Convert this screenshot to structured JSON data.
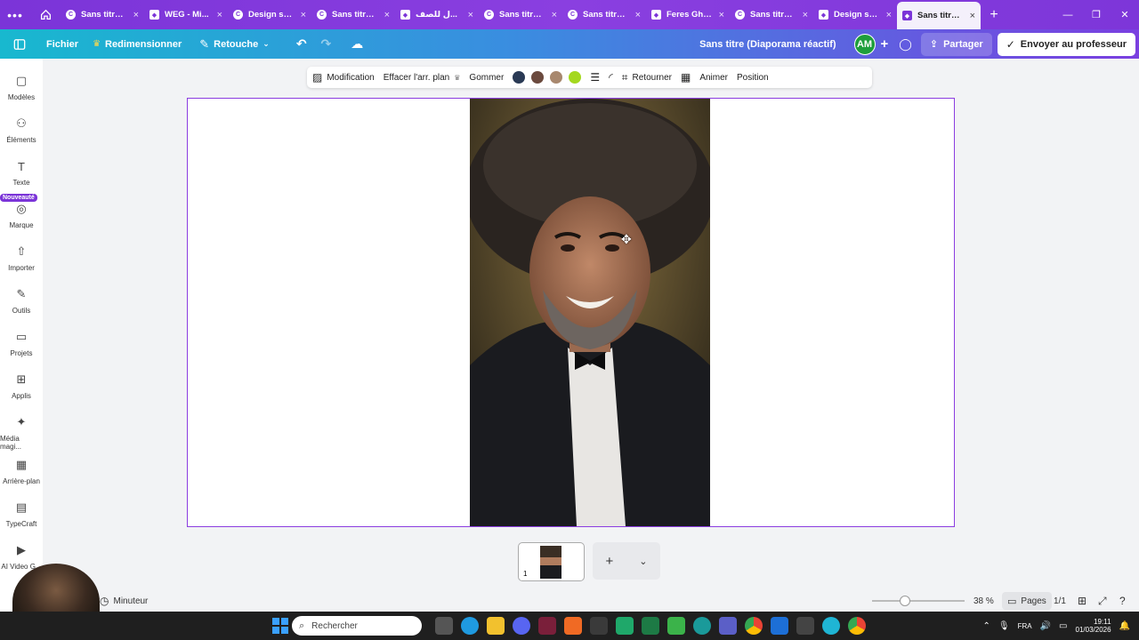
{
  "browser": {
    "tabs": [
      {
        "title": "Sans titre ...",
        "icon": "canva",
        "active": false
      },
      {
        "title": "WEG - Mi...",
        "icon": "shield",
        "active": false
      },
      {
        "title": "Design sa...",
        "icon": "canva",
        "active": false
      },
      {
        "title": "Sans titre ...",
        "icon": "canva",
        "active": false
      },
      {
        "title": "ل للصف...",
        "icon": "shield",
        "active": false
      },
      {
        "title": "Sans titre ...",
        "icon": "canva",
        "active": false
      },
      {
        "title": "Sans titre ...",
        "icon": "canva",
        "active": false
      },
      {
        "title": "Feres Gha...",
        "icon": "shield",
        "active": false
      },
      {
        "title": "Sans titre ...",
        "icon": "canva",
        "active": false
      },
      {
        "title": "Design sa...",
        "icon": "shield",
        "active": false
      },
      {
        "title": "Sans titre ...",
        "icon": "shield",
        "active": true
      }
    ],
    "close_glyph": "×",
    "new_tab": "+"
  },
  "header": {
    "file": "Fichier",
    "resize": "Redimensionner",
    "retouch": "Retouche",
    "doc_title": "Sans titre (Diaporama réactif)",
    "avatar": "AM",
    "share": "Partager",
    "send_teacher": "Envoyer au professeur"
  },
  "sidebar": {
    "items": [
      {
        "label": "Modèles",
        "icon": "templates-icon"
      },
      {
        "label": "Éléments",
        "icon": "elements-icon"
      },
      {
        "label": "Texte",
        "icon": "text-icon"
      },
      {
        "label": "Marque",
        "icon": "brand-icon"
      },
      {
        "label": "Importer",
        "icon": "upload-icon"
      },
      {
        "label": "Outils",
        "icon": "tools-icon"
      },
      {
        "label": "Projets",
        "icon": "folder-icon"
      },
      {
        "label": "Applis",
        "icon": "apps-icon"
      },
      {
        "label": "Média magi...",
        "icon": "magic-media-icon"
      },
      {
        "label": "Arrière-plan",
        "icon": "background-icon"
      },
      {
        "label": "TypeCraft",
        "icon": "typecraft-icon"
      },
      {
        "label": "AI Video G...",
        "icon": "ai-video-icon"
      }
    ],
    "new_badge": "Nouveauté"
  },
  "context_toolbar": {
    "edit": "Modification",
    "remove_bg": "Effacer l'arr. plan",
    "erase": "Gommer",
    "swatches": [
      "#2a3a55",
      "#6b4a3e",
      "#a8886e",
      "#a4d81e"
    ],
    "flip": "Retourner",
    "animate": "Animer",
    "position": "Position"
  },
  "pages": {
    "thumb_number": "1",
    "add": "+"
  },
  "footer": {
    "timer": "Minuteur",
    "zoom": "38 %",
    "pages_label": "Pages",
    "page_count": "1/1",
    "zoom_level": 0.38
  },
  "taskbar": {
    "search_placeholder": "Rechercher",
    "lang": "FRA",
    "time": "19:11",
    "date": "01/03/2026"
  },
  "colors": {
    "canva_purple": "#7b34d8",
    "canvas_bg": "#f2f3f5",
    "frame_border": "#8b3de0"
  }
}
